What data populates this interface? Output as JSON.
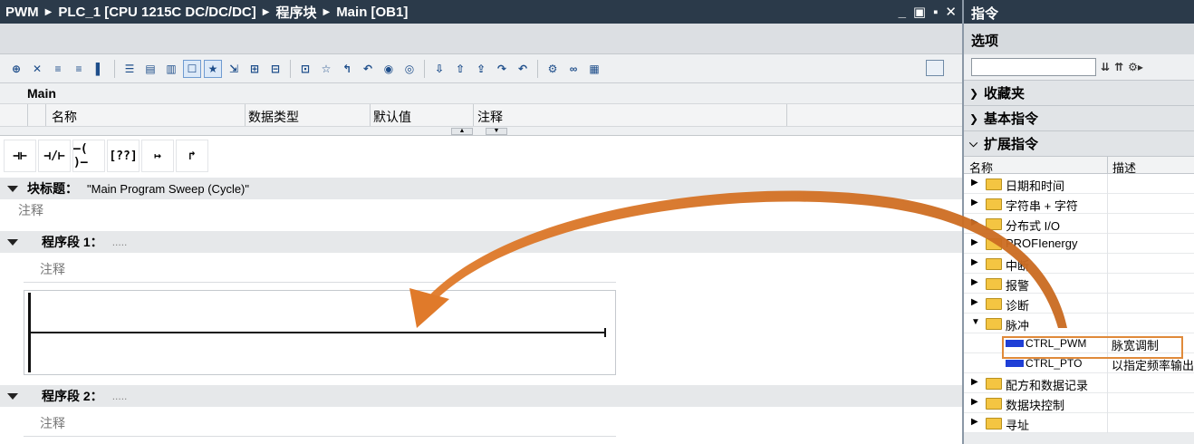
{
  "title_bar": {
    "crumbs": [
      "PWM",
      "PLC_1 [CPU 1215C DC/DC/DC]",
      "程序块",
      "Main [OB1]"
    ],
    "controls": [
      "_",
      "▣",
      "▪",
      "✕"
    ]
  },
  "toolbar": {
    "icons": [
      "add-network",
      "delete-network",
      "insert-row",
      "add-row",
      "set-clear",
      "compare",
      "open-all",
      "close-all",
      "show-comments",
      "favorites",
      "absolute-operand",
      "show-tags",
      "hide-tags",
      "network-view",
      "insert-box",
      "go-first",
      "go-prev",
      "monitor-on",
      "monitor-off",
      "download",
      "upload-a",
      "upload-b",
      "jump-a",
      "jump-b",
      "settings",
      "glasses",
      "database"
    ]
  },
  "interface": {
    "title": "Main",
    "columns": [
      "名称",
      "数据类型",
      "默认值",
      "注释"
    ]
  },
  "ladder_tools": [
    "⊣⊢",
    "⊣/⊢",
    "–( )–",
    "[??]",
    "↦",
    "↱"
  ],
  "block_title": {
    "label": "块标题：",
    "value": "\"Main Program Sweep (Cycle)\"",
    "comment": "注释"
  },
  "networks": [
    {
      "label": "程序段 1：",
      "dots": ".....",
      "comment": "注释"
    },
    {
      "label": "程序段 2：",
      "dots": ".....",
      "comment": "注释"
    }
  ],
  "panel": {
    "title": "指令",
    "options": "选项",
    "search_placeholder": "",
    "categories": [
      "收藏夹",
      "基本指令",
      "扩展指令"
    ],
    "columns": {
      "name": "名称",
      "desc": "描述"
    },
    "rows": [
      {
        "label": "日期和时间",
        "type": "folder",
        "expanded": false,
        "desc": ""
      },
      {
        "label": "字符串 + 字符",
        "type": "folder",
        "expanded": false,
        "desc": ""
      },
      {
        "label": "分布式 I/O",
        "type": "folder",
        "expanded": false,
        "desc": ""
      },
      {
        "label": "PROFIenergy",
        "type": "folder",
        "expanded": false,
        "desc": ""
      },
      {
        "label": "中断",
        "type": "folder",
        "expanded": false,
        "desc": ""
      },
      {
        "label": "报警",
        "type": "folder",
        "expanded": false,
        "desc": ""
      },
      {
        "label": "诊断",
        "type": "folder",
        "expanded": false,
        "desc": ""
      },
      {
        "label": "脉冲",
        "type": "folder",
        "expanded": true,
        "desc": ""
      },
      {
        "label": "CTRL_PWM",
        "type": "instruction",
        "desc": "脉宽调制"
      },
      {
        "label": "CTRL_PTO",
        "type": "instruction",
        "desc": "以指定频率输出"
      },
      {
        "label": "配方和数据记录",
        "type": "folder",
        "expanded": false,
        "desc": ""
      },
      {
        "label": "数据块控制",
        "type": "folder",
        "expanded": false,
        "desc": ""
      },
      {
        "label": "寻址",
        "type": "folder",
        "expanded": false,
        "desc": ""
      }
    ]
  },
  "colors": {
    "title_bg": "#2b3a4a",
    "highlight": "#e08a3a",
    "arrow": "#e07a2a",
    "instruction_icon": "#1f3fd6"
  }
}
